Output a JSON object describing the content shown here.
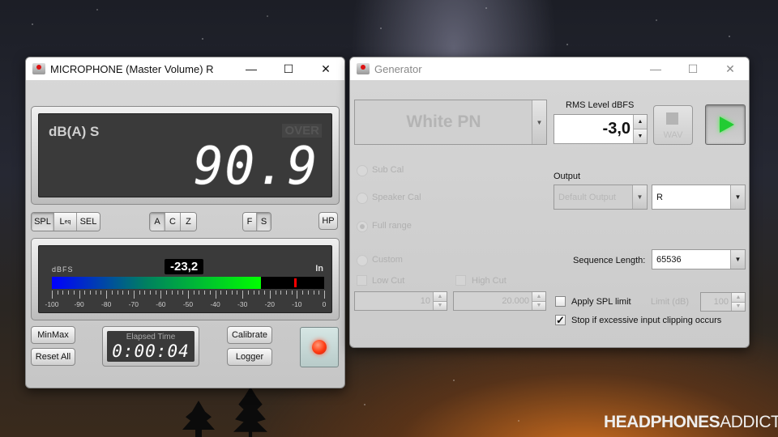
{
  "meter_window": {
    "title": "MICROPHONE (Master Volume) R",
    "minimize": "—",
    "maximize": "☐",
    "close": "✕",
    "mode_label": "dB(A) S",
    "over_label": "OVER",
    "main_value": "90.9",
    "buttons": {
      "spl": "SPL",
      "leq": "L",
      "leq_sub": "eq",
      "sel": "SEL",
      "a": "A",
      "c": "C",
      "z": "Z",
      "f": "F",
      "s": "S",
      "hp": "HP",
      "minmax": "MinMax",
      "reset_all": "Reset All",
      "calibrate": "Calibrate",
      "logger": "Logger"
    },
    "active": {
      "measure": "SPL",
      "weighting": "A",
      "time": "S"
    },
    "level_meter": {
      "unit_label": "dBFS",
      "input_label": "In",
      "readout": "-23,2",
      "level_dbfs": -23.2,
      "peak_dbfs": -11,
      "scale_min": -100,
      "scale_max": 0,
      "tick_labels": [
        "-100",
        "-90",
        "-80",
        "-70",
        "-60",
        "-50",
        "-40",
        "-30",
        "-20",
        "-10",
        "0"
      ]
    },
    "timer": {
      "label": "Elapsed Time",
      "value": "0:00:04"
    },
    "record_state": "recording"
  },
  "generator_window": {
    "title": "Generator",
    "minimize": "—",
    "maximize": "☐",
    "close": "✕",
    "signal_type": "White PN",
    "rms_label": "RMS Level dBFS",
    "rms_value": "-3,0",
    "wav_label": "WAV",
    "play_label": "play",
    "radios": [
      {
        "label": "Sub Cal",
        "selected": false
      },
      {
        "label": "Speaker Cal",
        "selected": false
      },
      {
        "label": "Full range",
        "selected": true
      },
      {
        "label": "Custom",
        "selected": false
      }
    ],
    "low_cut": {
      "label": "Low Cut",
      "value": "10"
    },
    "high_cut": {
      "label": "High Cut",
      "value": "20.000"
    },
    "output_label": "Output",
    "output_device": "Default Output",
    "output_channel": "R",
    "sequence_label": "Sequence Length:",
    "sequence_value": "65536",
    "apply_spl_label": "Apply SPL limit",
    "apply_spl_checked": false,
    "limit_label": "Limit (dB)",
    "limit_value": "100",
    "stop_clipping_label": "Stop if excessive input clipping occurs",
    "stop_clipping_checked": true,
    "check_mark": "✓"
  },
  "watermark": {
    "bold": "HEADPHONES",
    "light": "ADDICT"
  }
}
